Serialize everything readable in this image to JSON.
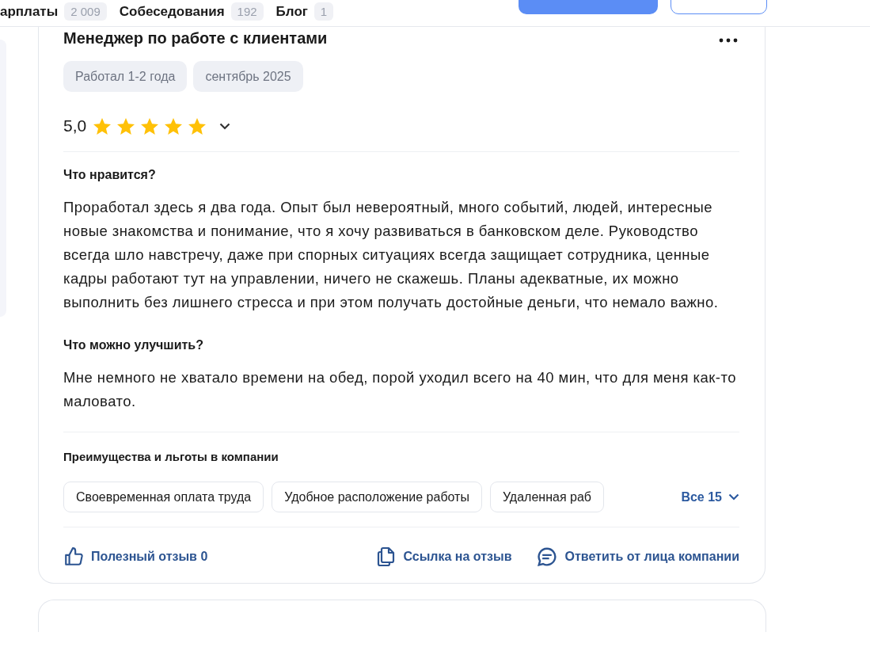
{
  "top_nav": {
    "items": [
      {
        "label": "арплаты",
        "count": "2 009"
      },
      {
        "label": "Собеседования",
        "count": "192"
      },
      {
        "label": "Блог",
        "count": "1"
      }
    ]
  },
  "review": {
    "title": "Менеджер по работе с клиентами",
    "tags": [
      "Работал 1-2 года",
      "сентябрь 2025"
    ],
    "rating": {
      "value": "5,0",
      "stars": 5
    },
    "sections": [
      {
        "heading": "Что нравится?",
        "text": "Проработал здесь я два года. Опыт был невероятный, много событий, людей, интересные новые знакомства и понимание, что я хочу развиваться в банковском деле. Руководство всегда шло навстречу, даже при спорных ситуациях всегда защищает сотрудника, ценные кадры работают тут на управлении, ничего не скажешь. Планы адекватные, их можно выполнить без лишнего стресса и при этом получать достойные деньги, что немало важно."
      },
      {
        "heading": "Что можно улучшить?",
        "text": "Мне немного не хватало времени на обед, порой уходил всего на 40 мин, что для меня как-то маловато."
      }
    ],
    "benefits": {
      "heading": "Преимущества и льготы в компании",
      "chips": [
        "Своевременная оплата труда",
        "Удобное расположение работы",
        "Удаленная раб"
      ],
      "more": "Все 15"
    },
    "actions": [
      {
        "kind": "like",
        "label": "Полезный отзыв 0"
      },
      {
        "kind": "link",
        "label": "Ссылка на отзыв"
      },
      {
        "kind": "reply",
        "label": "Ответить от лица компании"
      }
    ]
  }
}
